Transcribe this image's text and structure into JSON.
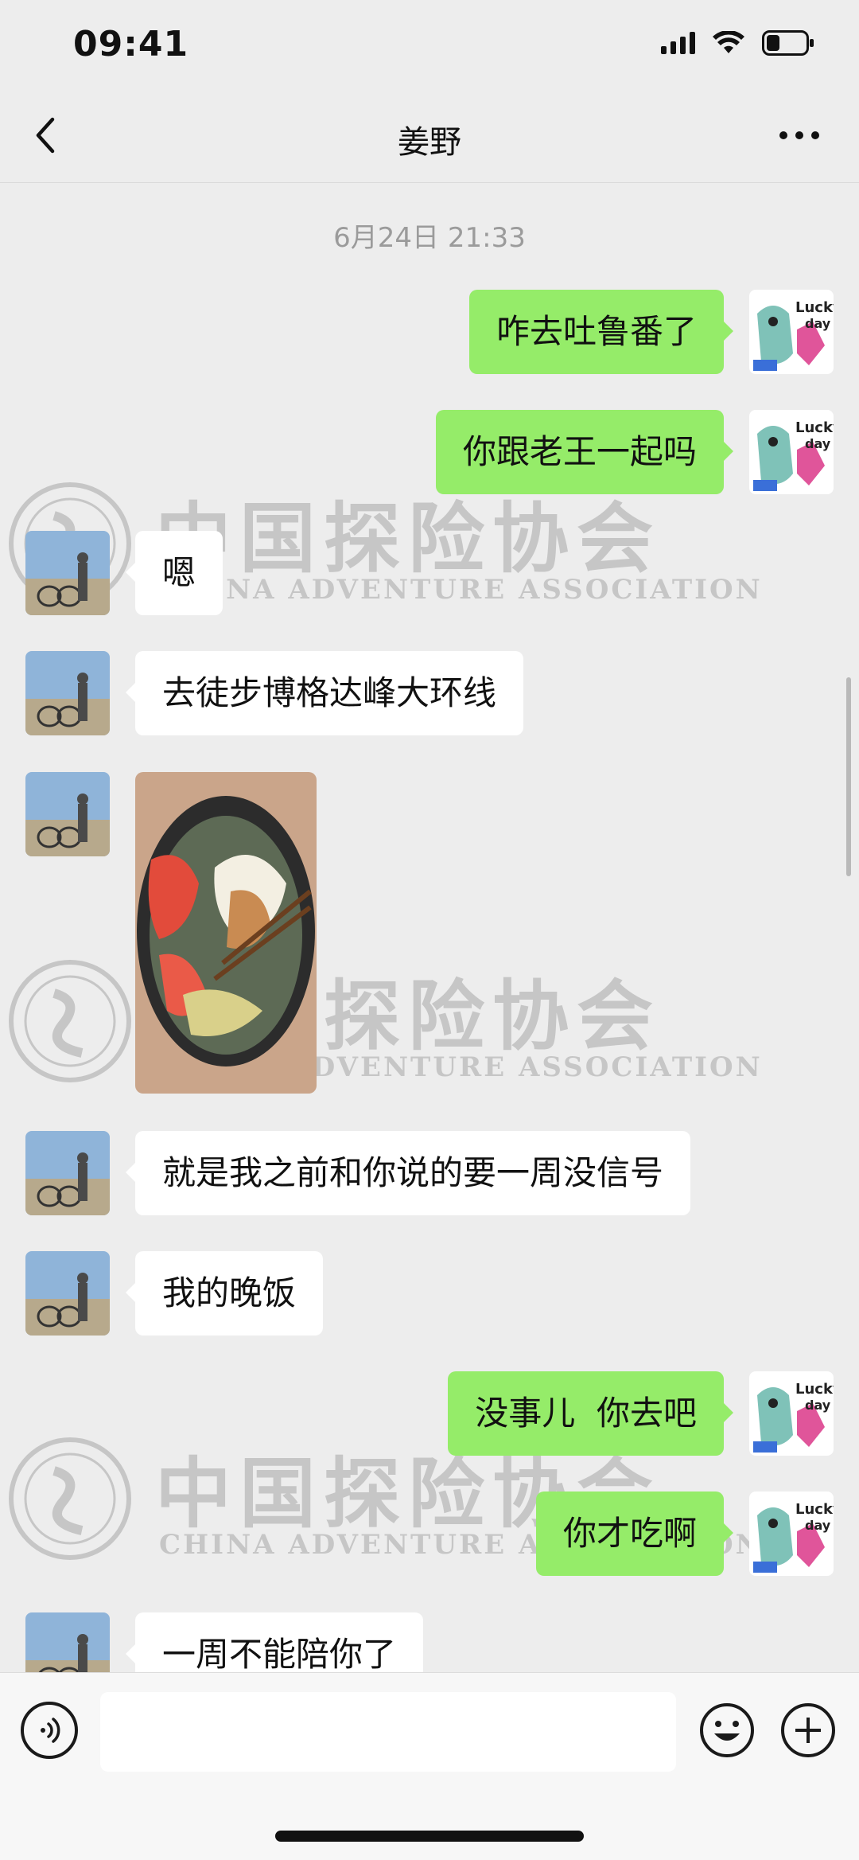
{
  "status_bar": {
    "time": "09:41"
  },
  "header": {
    "title": "姜野"
  },
  "chat": {
    "timestamp": "6月24日 21:33",
    "messages": [
      {
        "side": "out",
        "text": "咋去吐鲁番了"
      },
      {
        "side": "out",
        "text": "你跟老王一起吗"
      },
      {
        "side": "in",
        "text": "嗯"
      },
      {
        "side": "in",
        "text": "去徒步博格达峰大环线"
      },
      {
        "side": "in",
        "type": "image",
        "content": "food-photo"
      },
      {
        "side": "in",
        "text": "就是我之前和你说的要一周没信号"
      },
      {
        "side": "in",
        "text": "我的晚饭"
      },
      {
        "side": "out",
        "text": "没事儿  你去吧"
      },
      {
        "side": "out",
        "text": "你才吃啊"
      },
      {
        "side": "in",
        "text": "一周不能陪你了"
      }
    ]
  },
  "watermark": {
    "cn": "中国探险协会",
    "en": "CHINA ADVENTURE ASSOCIATION"
  },
  "input_bar": {
    "placeholder": "",
    "icons": [
      "voice-icon",
      "emoji-icon",
      "plus-icon"
    ]
  },
  "colors": {
    "outgoing_bubble": "#95ec69",
    "incoming_bubble": "#ffffff",
    "background": "#ededed"
  }
}
